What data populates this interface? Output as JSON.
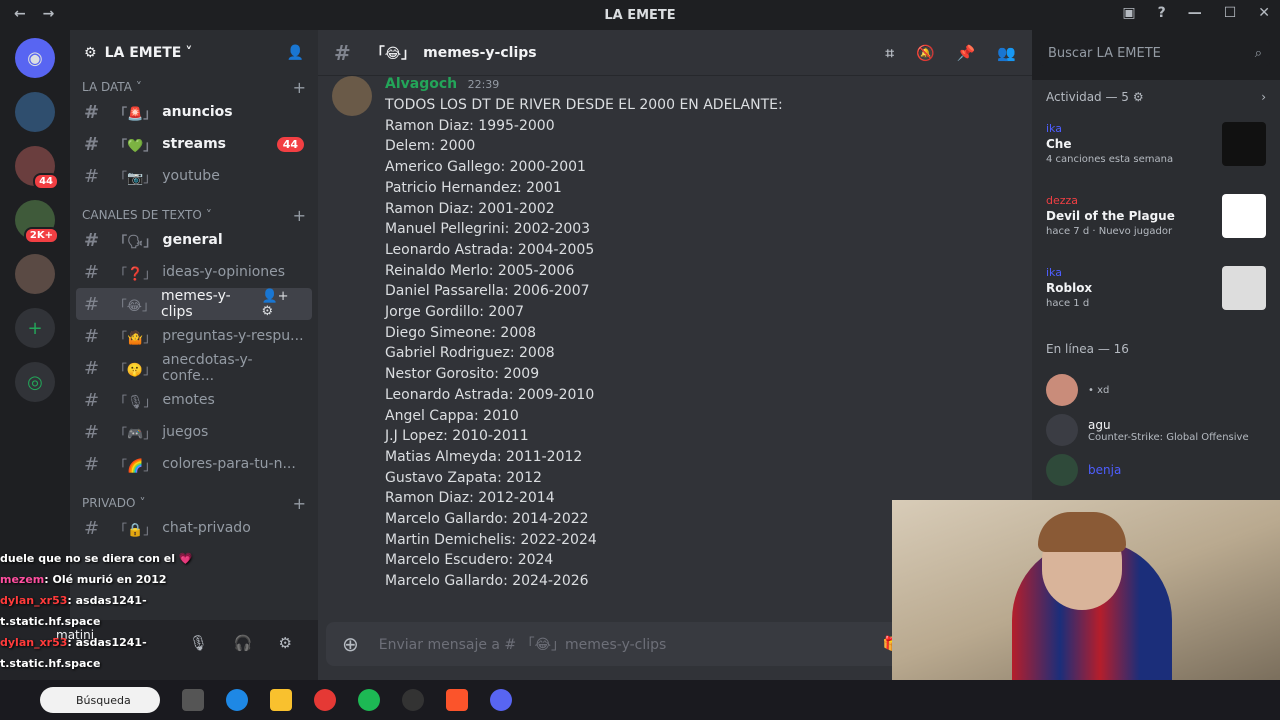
{
  "window": {
    "title": "LA EMETE"
  },
  "server": {
    "name": "LA EMETE"
  },
  "sidebar": {
    "categories": [
      {
        "label": "LA DATA",
        "channels": [
          {
            "name": "anuncios",
            "icon": "🚨",
            "state": "unread"
          },
          {
            "name": "streams",
            "icon": "💚",
            "state": "unread",
            "mentions": "44"
          },
          {
            "name": "youtube",
            "icon": "📷",
            "state": "normal"
          }
        ]
      },
      {
        "label": "CANALES DE TEXTO",
        "channels": [
          {
            "name": "general",
            "icon": "🗣",
            "state": "unread"
          },
          {
            "name": "ideas-y-opiniones",
            "icon": "❓",
            "state": "normal"
          },
          {
            "name": "memes-y-clips",
            "icon": "😂",
            "state": "active"
          },
          {
            "name": "preguntas-y-respu...",
            "icon": "🤷",
            "state": "normal"
          },
          {
            "name": "anecdotas-y-confe...",
            "icon": "🤫",
            "state": "normal"
          },
          {
            "name": "emotes",
            "icon": "🎙",
            "state": "normal"
          },
          {
            "name": "juegos",
            "icon": "🎮",
            "state": "normal"
          },
          {
            "name": "colores-para-tu-n...",
            "icon": "🌈",
            "state": "normal"
          }
        ]
      },
      {
        "label": "PRIVADO",
        "channels": [
          {
            "name": "chat-privado",
            "icon": "🔒",
            "state": "normal"
          }
        ]
      }
    ]
  },
  "channel_header": {
    "name": "memes-y-clips",
    "icon": "😂"
  },
  "search": {
    "placeholder": "Buscar LA EMETE"
  },
  "message": {
    "author": "Alvagoch",
    "time": "22:39",
    "lines": [
      "TODOS LOS DT DE RIVER DESDE EL 2000 EN ADELANTE:",
      "Ramon Diaz: 1995-2000",
      "Delem: 2000",
      "Americo Gallego: 2000-2001",
      "Patricio Hernandez: 2001",
      "Ramon Diaz: 2001-2002",
      "Manuel Pellegrini: 2002-2003",
      "Leonardo Astrada: 2004-2005",
      "Reinaldo Merlo: 2005-2006",
      "Daniel Passarella: 2006-2007",
      "Jorge Gordillo: 2007",
      "Diego Simeone: 2008",
      "Gabriel Rodriguez: 2008",
      "Nestor Gorosito: 2009",
      "Leonardo Astrada: 2009-2010",
      "Angel Cappa: 2010",
      "J.J Lopez: 2010-2011",
      "Matias Almeyda: 2011-2012",
      "Gustavo Zapata: 2012",
      "Ramon Diaz: 2012-2014",
      "Marcelo Gallardo: 2014-2022",
      "Martin Demichelis: 2022-2024",
      "Marcelo Escudero: 2024",
      "Marcelo Gallardo: 2024-2026"
    ]
  },
  "composer": {
    "placeholder": "Enviar mensaje a # 「😂」memes-y-clips"
  },
  "activity": {
    "title": "Actividad — 5",
    "items": [
      {
        "user": "ika",
        "title": "Che",
        "sub": "4 canciones esta semana"
      },
      {
        "user": "dezza",
        "title": "Devil of the Plague",
        "sub": "hace 7 d · Nuevo jugador"
      },
      {
        "user": "ika",
        "title": "Roblox",
        "sub": "hace 1 d"
      }
    ]
  },
  "online": {
    "title": "En línea — 16",
    "members": [
      {
        "name": "",
        "status": "• xd"
      },
      {
        "name": "agu",
        "status": "Counter-Strike: Global Offensive"
      },
      {
        "name": "benja",
        "status": ""
      }
    ]
  },
  "user_panel": {
    "name": "matini"
  },
  "guild_badges": {
    "first": "44",
    "second": "2K+"
  },
  "chat_overlay": [
    {
      "user": "",
      "text": "duele que no se diera con el 💗"
    },
    {
      "user": "mezem",
      "text": ": Olé murió en 2012"
    },
    {
      "user": "dylan_xr53",
      "text": ": asdas1241-"
    },
    {
      "user": "",
      "text": "t.static.hf.space"
    },
    {
      "user": "dylan_xr53",
      "text": ": asdas1241-"
    },
    {
      "user": "",
      "text": "t.static.hf.space"
    }
  ],
  "taskbar": {
    "search_label": "Búsqueda"
  }
}
